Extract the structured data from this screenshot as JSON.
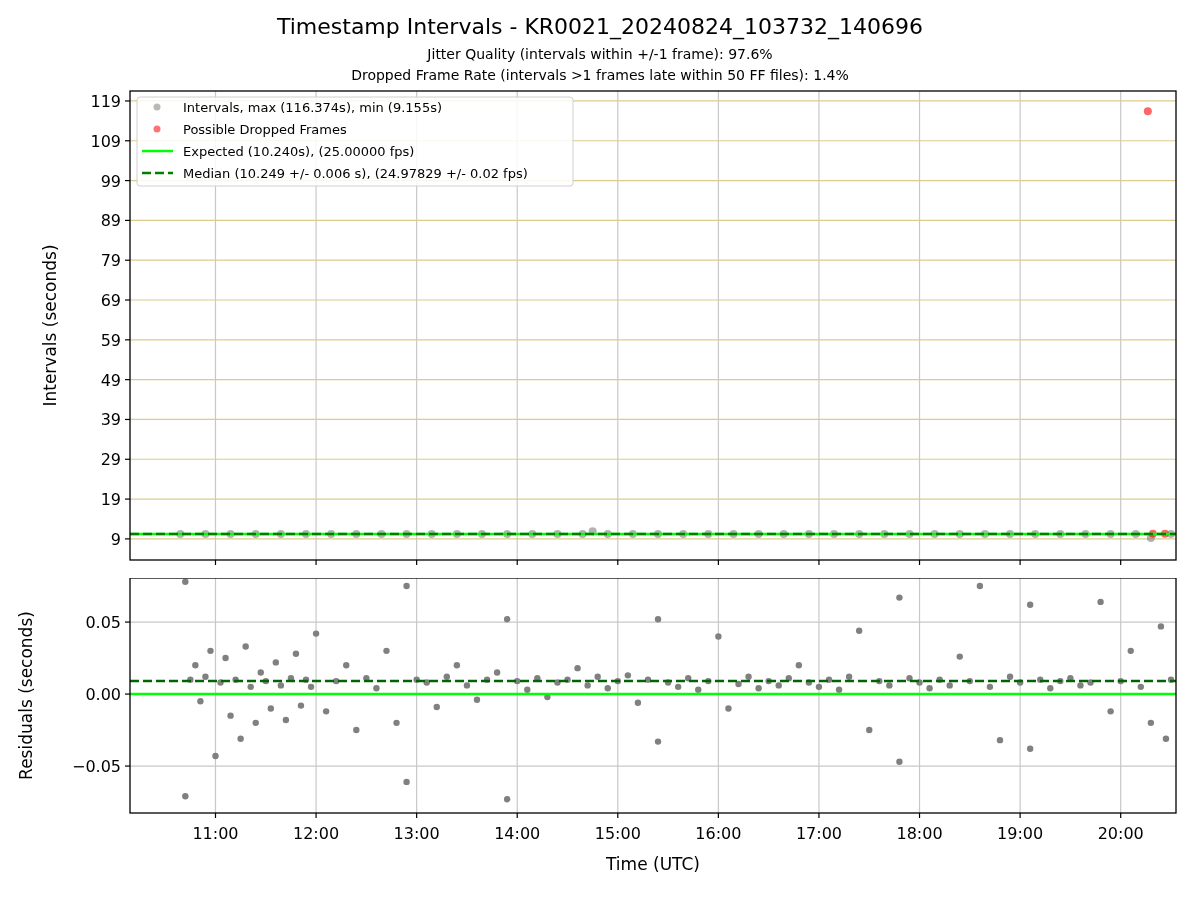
{
  "figure": {
    "title": "Timestamp Intervals - KR0021_20240824_103732_140696",
    "subtitles": [
      "Jitter Quality (intervals within +/-1 frame): 97.6%",
      "Dropped Frame Rate (intervals >1 frames late within 50 FF files): 1.4%"
    ]
  },
  "charts": [
    {
      "chart_data": {
        "type": "scatter",
        "ylabel": "Intervals (seconds)",
        "xlim": [
          10.15,
          20.55
        ],
        "ylim": [
          3.7,
          121.5
        ],
        "grid": true,
        "legend": true,
        "yticks": [
          {
            "value": 9,
            "label": "9"
          },
          {
            "value": 19,
            "label": "19"
          },
          {
            "value": 29,
            "label": "29"
          },
          {
            "value": 39,
            "label": "39"
          },
          {
            "value": 49,
            "label": "49"
          },
          {
            "value": 59,
            "label": "59"
          },
          {
            "value": 69,
            "label": "69"
          },
          {
            "value": 79,
            "label": "79"
          },
          {
            "value": 89,
            "label": "89"
          },
          {
            "value": 99,
            "label": "99"
          },
          {
            "value": 109,
            "label": "109"
          },
          {
            "value": 119,
            "label": "119"
          }
        ],
        "series": [
          {
            "name": "Intervals, max (116.374s), min (9.155s)",
            "type": "scatter",
            "color": "#808080",
            "x": [
              10.65,
              10.9,
              11.15,
              11.4,
              11.65,
              11.9,
              12.15,
              12.4,
              12.65,
              12.9,
              13.15,
              13.4,
              13.65,
              13.9,
              14.15,
              14.4,
              14.65,
              14.75,
              14.9,
              15.15,
              15.4,
              15.65,
              15.9,
              16.15,
              16.4,
              16.65,
              16.9,
              17.15,
              17.4,
              17.65,
              17.9,
              18.15,
              18.4,
              18.65,
              18.9,
              19.15,
              19.4,
              19.65,
              19.9,
              20.15,
              20.3,
              20.5
            ],
            "values": [
              10.2,
              10.2,
              10.2,
              10.2,
              10.2,
              10.2,
              10.2,
              10.2,
              10.2,
              10.2,
              10.2,
              10.2,
              10.2,
              10.2,
              10.2,
              10.2,
              10.2,
              10.9,
              10.2,
              10.2,
              10.2,
              10.2,
              10.2,
              10.2,
              10.2,
              10.2,
              10.2,
              10.2,
              10.2,
              10.2,
              10.2,
              10.2,
              10.2,
              10.2,
              10.2,
              10.2,
              10.2,
              10.2,
              10.2,
              10.2,
              9.2,
              10.2
            ]
          },
          {
            "name": "Possible Dropped Frames",
            "type": "scatter",
            "color": "#ff0000",
            "x": [
              20.27,
              20.32,
              20.44
            ],
            "values": [
              116.4,
              10.3,
              10.3
            ]
          },
          {
            "name": "Expected (10.240s), (25.00000 fps)",
            "type": "line",
            "color": "#00ff00",
            "x": [
              10.15,
              20.55
            ],
            "values": [
              10.2,
              10.2
            ]
          },
          {
            "name": "Median (10.249 +/- 0.006 s), (24.97829 +/- 0.02 fps)",
            "type": "line",
            "line_style": "dashed",
            "color": "#008000",
            "x": [
              10.15,
              20.55
            ],
            "values": [
              10.2,
              10.2
            ]
          }
        ]
      }
    },
    {
      "chart_data": {
        "type": "scatter",
        "xlabel": "Time (UTC)",
        "ylabel": "Residuals (seconds)",
        "xlim": [
          10.15,
          20.55
        ],
        "ylim": [
          -0.0826,
          0.0806
        ],
        "grid": true,
        "xticks": [
          {
            "value": 11,
            "label": "11:00"
          },
          {
            "value": 12,
            "label": "12:00"
          },
          {
            "value": 13,
            "label": "13:00"
          },
          {
            "value": 14,
            "label": "14:00"
          },
          {
            "value": 15,
            "label": "15:00"
          },
          {
            "value": 16,
            "label": "16:00"
          },
          {
            "value": 17,
            "label": "17:00"
          },
          {
            "value": 18,
            "label": "18:00"
          },
          {
            "value": 19,
            "label": "19:00"
          },
          {
            "value": 20,
            "label": "20:00"
          }
        ],
        "yticks": [
          {
            "value": -0.05,
            "label": "−0.05"
          },
          {
            "value": 0,
            "label": "0.00"
          },
          {
            "value": 0.05,
            "label": "0.05"
          }
        ],
        "series": [
          {
            "type": "scatter",
            "color": "#808080",
            "x": [
              10.7,
              10.7,
              10.75,
              10.8,
              10.85,
              10.9,
              10.95,
              11.0,
              11.05,
              11.1,
              11.15,
              11.2,
              11.25,
              11.3,
              11.35,
              11.4,
              11.45,
              11.5,
              11.55,
              11.6,
              11.65,
              11.7,
              11.75,
              11.8,
              11.85,
              11.9,
              11.95,
              12.0,
              12.1,
              12.2,
              12.3,
              12.4,
              12.5,
              12.6,
              12.7,
              12.8,
              12.9,
              12.9,
              13.0,
              13.1,
              13.2,
              13.3,
              13.4,
              13.5,
              13.6,
              13.7,
              13.8,
              13.9,
              13.9,
              14.0,
              14.1,
              14.2,
              14.3,
              14.4,
              14.5,
              14.6,
              14.7,
              14.8,
              14.9,
              15.0,
              15.1,
              15.2,
              15.3,
              15.4,
              15.4,
              15.5,
              15.6,
              15.7,
              15.8,
              15.9,
              16.0,
              16.1,
              16.2,
              16.3,
              16.4,
              16.5,
              16.6,
              16.7,
              16.8,
              16.9,
              17.0,
              17.1,
              17.2,
              17.3,
              17.4,
              17.5,
              17.6,
              17.7,
              17.8,
              17.8,
              17.9,
              18.0,
              18.1,
              18.2,
              18.3,
              18.4,
              18.5,
              18.6,
              18.7,
              18.8,
              18.9,
              19.0,
              19.1,
              19.1,
              19.2,
              19.3,
              19.4,
              19.5,
              19.6,
              19.7,
              19.8,
              19.9,
              20.0,
              20.1,
              20.2,
              20.3,
              20.4,
              20.45,
              20.5
            ],
            "values": [
              0.078,
              -0.071,
              0.01,
              0.02,
              -0.005,
              0.012,
              0.03,
              -0.043,
              0.008,
              0.025,
              -0.015,
              0.01,
              -0.031,
              0.033,
              0.005,
              -0.02,
              0.015,
              0.009,
              -0.01,
              0.022,
              0.006,
              -0.018,
              0.011,
              0.028,
              -0.008,
              0.01,
              0.005,
              0.042,
              -0.012,
              0.009,
              0.02,
              -0.025,
              0.011,
              0.004,
              0.03,
              -0.02,
              0.075,
              -0.061,
              0.01,
              0.008,
              -0.009,
              0.012,
              0.02,
              0.006,
              -0.004,
              0.01,
              0.015,
              -0.073,
              0.052,
              0.009,
              0.003,
              0.011,
              -0.002,
              0.008,
              0.01,
              0.018,
              0.006,
              0.012,
              0.004,
              0.009,
              0.013,
              -0.006,
              0.01,
              0.052,
              -0.033,
              0.008,
              0.005,
              0.011,
              0.003,
              0.009,
              0.04,
              -0.01,
              0.007,
              0.012,
              0.004,
              0.009,
              0.006,
              0.011,
              0.02,
              0.008,
              0.005,
              0.01,
              0.003,
              0.012,
              0.044,
              -0.025,
              0.009,
              0.006,
              0.067,
              -0.047,
              0.011,
              0.008,
              0.004,
              0.01,
              0.006,
              0.026,
              0.009,
              0.075,
              0.005,
              -0.032,
              0.012,
              0.008,
              0.062,
              -0.038,
              0.01,
              0.004,
              0.009,
              0.011,
              0.006,
              0.008,
              0.064,
              -0.012,
              0.009,
              0.03,
              0.005,
              -0.02,
              0.047,
              -0.031,
              0.01
            ]
          },
          {
            "type": "line",
            "color": "#00ff00",
            "x": [
              10.15,
              20.55
            ],
            "values": [
              0,
              0
            ]
          },
          {
            "type": "line",
            "line_style": "dashed",
            "color": "#006400",
            "x": [
              10.15,
              20.55
            ],
            "values": [
              0.009,
              0.009
            ]
          }
        ]
      }
    }
  ]
}
